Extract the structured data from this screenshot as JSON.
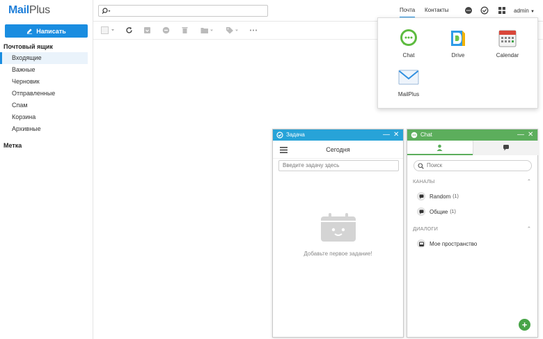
{
  "app": {
    "logo_mail": "Mail",
    "logo_plus": "Plus"
  },
  "sidebar": {
    "compose_label": "Написать",
    "mailbox_title": "Почтовый ящик",
    "folders": [
      "Входящие",
      "Важные",
      "Черновик",
      "Отправленные",
      "Спам",
      "Корзина",
      "Архивные"
    ],
    "label_title": "Метка"
  },
  "topbar": {
    "tab_mail": "Почта",
    "tab_contacts": "Контакты",
    "user": "admin"
  },
  "app_menu": {
    "apps": [
      "Chat",
      "Drive",
      "Calendar",
      "MailPlus"
    ]
  },
  "task_window": {
    "title": "Задача",
    "today": "Сегодня",
    "input_placeholder": "Введите задачу здесь",
    "empty_text": "Добавьте первое задание!"
  },
  "chat_window": {
    "title": "Chat",
    "search_placeholder": "Поиск",
    "channels_title": "КАНАЛЫ",
    "channels": [
      {
        "name": "Random",
        "count": "(1)"
      },
      {
        "name": "Общие",
        "count": "(1)"
      }
    ],
    "dialogs_title": "ДИАЛОГИ",
    "dialogs": [
      {
        "name": "Мое пространство"
      }
    ],
    "fab_label": "+"
  },
  "colors": {
    "accent": "#1a8de0",
    "task_header": "#27a3d8",
    "chat_header": "#5cae5c"
  }
}
